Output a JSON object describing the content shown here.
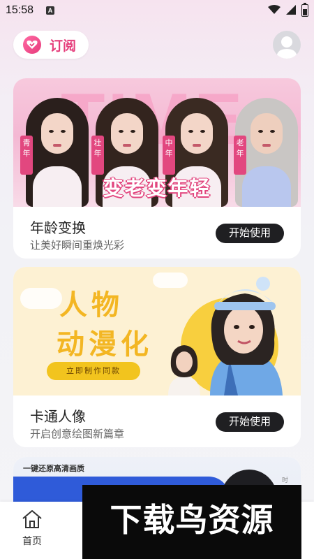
{
  "status_bar": {
    "time": "15:58",
    "notification_badge": "A"
  },
  "header": {
    "subscribe_label": "订阅",
    "avatar_icon": "user-avatar-icon"
  },
  "cards": [
    {
      "banner": {
        "big_word": "TIME",
        "age_tags": [
          "青年",
          "壮年",
          "中年",
          "老年"
        ],
        "slogan": "变老变年轻"
      },
      "title": "年龄变换",
      "subtitle": "让美好瞬间重焕光彩",
      "button": "开始使用"
    },
    {
      "banner": {
        "line1": "人物",
        "line2": "动漫化",
        "cta": "立即制作同款"
      },
      "title": "卡通人像",
      "subtitle": "开启创意绘图新篇章",
      "button": "开始使用"
    },
    {
      "banner": {
        "headline": "一键还原高清画质",
        "corner_text": "时"
      }
    }
  ],
  "bottom_nav": {
    "home_label": "首页"
  },
  "watermark": "下载鸟资源",
  "colors": {
    "accent_pink": "#e53d7b",
    "button_dark": "#1f1f22",
    "anime_yellow": "#f3b623"
  }
}
